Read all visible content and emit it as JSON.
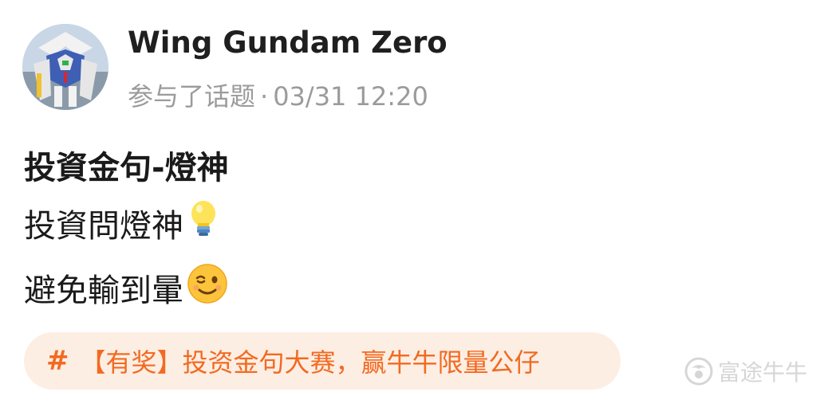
{
  "author": {
    "name": "Wing Gundam Zero",
    "action": "参与了话题",
    "separator": "·",
    "timestamp": "03/31 12:20",
    "avatar_icon": "gundam-avatar"
  },
  "post": {
    "title": "投資金句-燈神",
    "lines": [
      {
        "text": "投資問燈神",
        "emoji": "light-bulb-icon"
      },
      {
        "text": "避免輸到暈",
        "emoji": "winking-face-icon"
      }
    ]
  },
  "topic": {
    "hash": "#",
    "label": "【有奖】投资金句大赛，赢牛牛限量公仔"
  },
  "watermark": {
    "text": "富途牛牛",
    "icon": "futu-logo-icon"
  },
  "colors": {
    "accent": "#f26a21",
    "chip_bg": "#fdeee3",
    "meta": "#9b9b9b"
  }
}
